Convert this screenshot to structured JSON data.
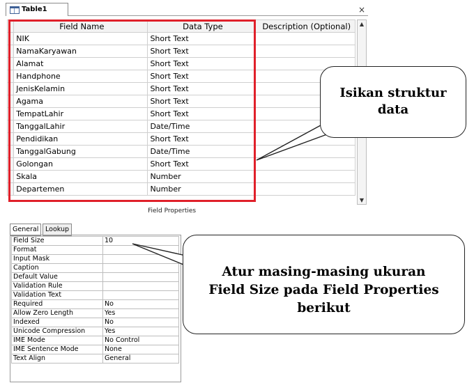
{
  "document_tab": {
    "title": "Table1",
    "close_label": "×"
  },
  "grid": {
    "headers": [
      "Field Name",
      "Data Type",
      "Description (Optional)"
    ],
    "rows": [
      {
        "name": "NIK",
        "type": "Short Text"
      },
      {
        "name": "NamaKaryawan",
        "type": "Short Text"
      },
      {
        "name": "Alamat",
        "type": "Short Text"
      },
      {
        "name": "Handphone",
        "type": "Short Text"
      },
      {
        "name": "JenisKelamin",
        "type": "Short Text"
      },
      {
        "name": "Agama",
        "type": "Short Text"
      },
      {
        "name": "TempatLahir",
        "type": "Short Text"
      },
      {
        "name": "TanggalLahir",
        "type": "Date/Time"
      },
      {
        "name": "Pendidikan",
        "type": "Short Text"
      },
      {
        "name": "TanggalGabung",
        "type": "Date/Time"
      },
      {
        "name": "Golongan",
        "type": "Short Text"
      },
      {
        "name": "Skala",
        "type": "Number"
      },
      {
        "name": "Departemen",
        "type": "Number"
      }
    ]
  },
  "field_properties": {
    "title": "Field Properties",
    "tabs": [
      "General",
      "Lookup"
    ],
    "rows": [
      {
        "key": "Field Size",
        "value": "10"
      },
      {
        "key": "Format",
        "value": ""
      },
      {
        "key": "Input Mask",
        "value": ""
      },
      {
        "key": "Caption",
        "value": ""
      },
      {
        "key": "Default Value",
        "value": ""
      },
      {
        "key": "Validation Rule",
        "value": ""
      },
      {
        "key": "Validation Text",
        "value": ""
      },
      {
        "key": "Required",
        "value": "No"
      },
      {
        "key": "Allow Zero Length",
        "value": "Yes"
      },
      {
        "key": "Indexed",
        "value": "No"
      },
      {
        "key": "Unicode Compression",
        "value": "Yes"
      },
      {
        "key": "IME Mode",
        "value": "No Control"
      },
      {
        "key": "IME Sentence Mode",
        "value": "None"
      },
      {
        "key": "Text Align",
        "value": "General"
      }
    ]
  },
  "callouts": {
    "structure": [
      "Isikan struktur",
      "data"
    ],
    "field_size": [
      "Atur masing-masing ukuran",
      "Field Size pada Field Properties",
      "berikut"
    ]
  },
  "colors": {
    "highlight": "#e0202a"
  },
  "icons": {
    "table": "table-icon",
    "close": "close-icon",
    "scroll_up": "scroll-up-arrow-icon",
    "scroll_down": "scroll-down-arrow-icon"
  }
}
